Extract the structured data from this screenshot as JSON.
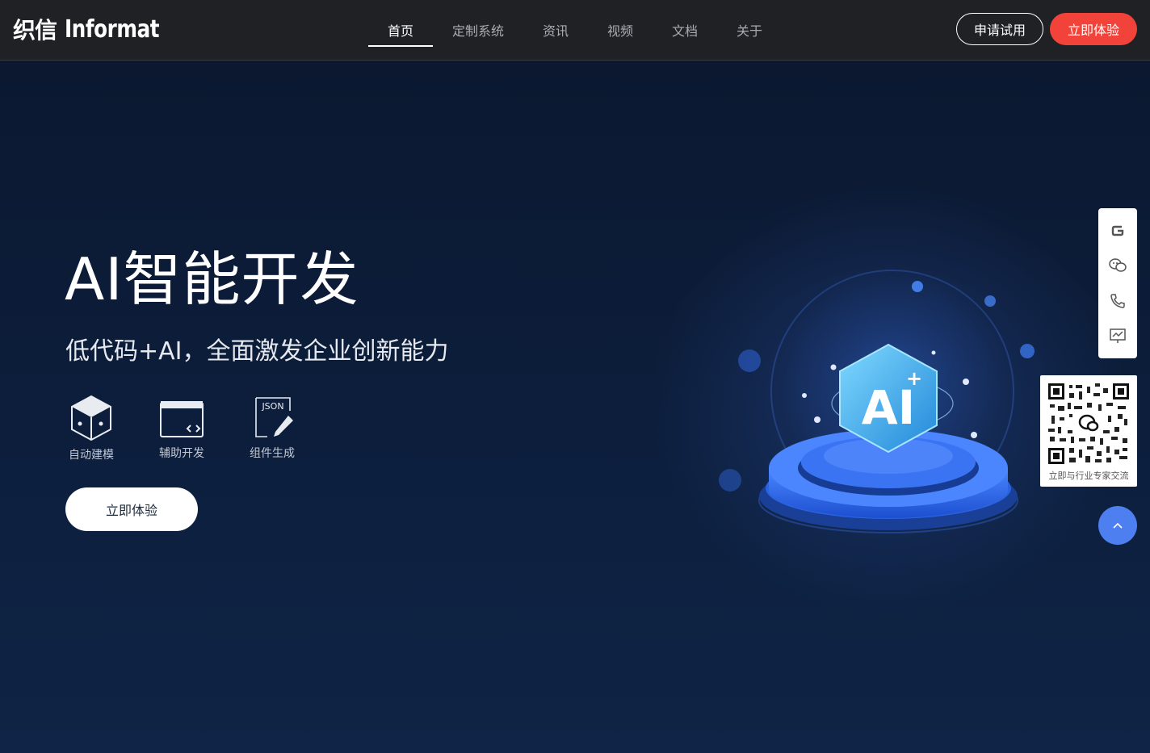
{
  "header": {
    "logo_cn": "织信",
    "logo_en": "Informat",
    "nav": [
      {
        "label": "首页",
        "active": true
      },
      {
        "label": "定制系统",
        "active": false
      },
      {
        "label": "资讯",
        "active": false
      },
      {
        "label": "视频",
        "active": false
      },
      {
        "label": "文档",
        "active": false
      },
      {
        "label": "关于",
        "active": false
      }
    ],
    "apply_trial_label": "申请试用",
    "try_now_label": "立即体验"
  },
  "hero": {
    "title": "AI智能开发",
    "subtitle": "低代码+AI，全面激发企业创新能力",
    "features": [
      {
        "label": "自动建模",
        "icon": "cube-icon"
      },
      {
        "label": "辅助开发",
        "icon": "code-window-icon"
      },
      {
        "label": "组件生成",
        "icon": "json-edit-icon"
      }
    ],
    "json_badge": "JSON",
    "cta_label": "立即体验",
    "illustration_text": "AI",
    "illustration_plus": "+"
  },
  "sidebar": {
    "icons": [
      "g-logo-icon",
      "wechat-icon",
      "phone-icon",
      "chart-icon"
    ],
    "qr_caption": "立即与行业专家交流"
  },
  "colors": {
    "header_bg": "#1f2124",
    "accent_red": "#f2433a",
    "hero_bg": "#0d1f3e",
    "to_top_blue": "#4d7ff0"
  }
}
